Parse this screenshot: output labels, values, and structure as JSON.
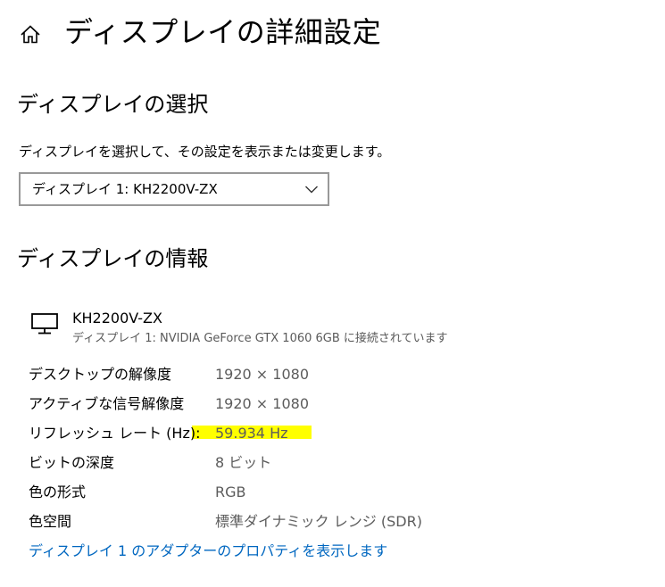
{
  "header": {
    "title": "ディスプレイの詳細設定",
    "home_icon": "home-icon"
  },
  "select_section": {
    "title": "ディスプレイの選択",
    "description": "ディスプレイを選択して、その設定を表示または変更します。",
    "dropdown": {
      "selected": "ディスプレイ 1: KH2200V-ZX",
      "icon": "chevron-down-icon"
    }
  },
  "info_section": {
    "title": "ディスプレイの情報",
    "monitor": {
      "icon": "monitor-icon",
      "name": "KH2200V-ZX",
      "subtitle": "ディスプレイ 1: NVIDIA GeForce GTX 1060 6GB に接続されています"
    },
    "rows": [
      {
        "label": "デスクトップの解像度",
        "value": "1920 × 1080"
      },
      {
        "label": "アクティブな信号解像度",
        "value": "1920 × 1080"
      },
      {
        "label": "リフレッシュ レート (Hz):",
        "value": "59.934 Hz"
      },
      {
        "label": "ビットの深度",
        "value": "8 ビット"
      },
      {
        "label": "色の形式",
        "value": "RGB"
      },
      {
        "label": "色空間",
        "value": "標準ダイナミック レンジ (SDR)"
      }
    ],
    "adapter_link": "ディスプレイ 1 のアダプターのプロパティを表示します"
  },
  "colors": {
    "link": "#0067c0",
    "highlight": "#ffff00",
    "secondary_text": "#5c5c5c"
  }
}
